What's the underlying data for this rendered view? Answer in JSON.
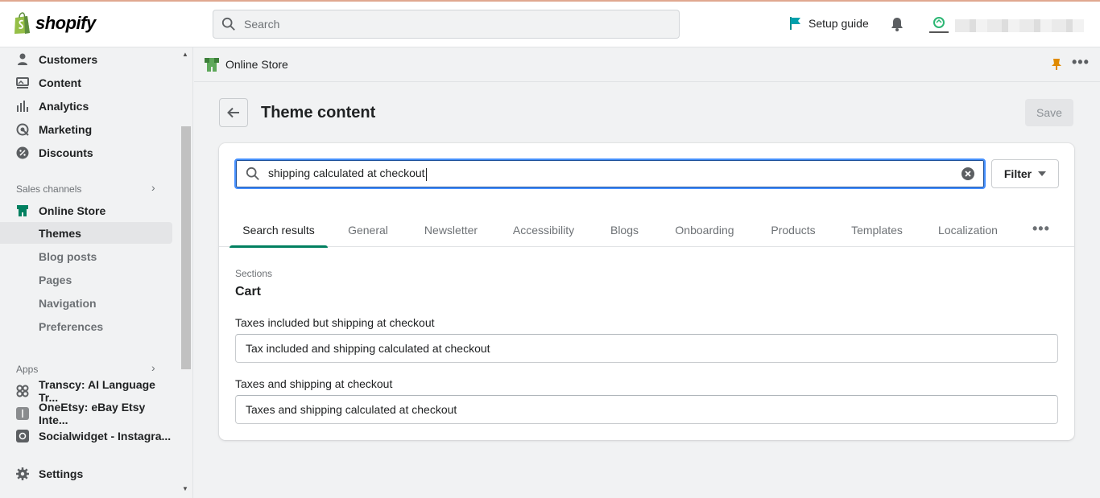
{
  "topbar": {
    "brand": "shopify",
    "search_placeholder": "Search",
    "setup_guide": "Setup guide"
  },
  "sidebar": {
    "items": [
      {
        "label": "Customers",
        "icon": "person-icon"
      },
      {
        "label": "Content",
        "icon": "content-icon"
      },
      {
        "label": "Analytics",
        "icon": "bar-chart-icon"
      },
      {
        "label": "Marketing",
        "icon": "target-icon"
      },
      {
        "label": "Discounts",
        "icon": "discount-icon"
      }
    ],
    "sales_channels_label": "Sales channels",
    "online_store_label": "Online Store",
    "sub_items": [
      "Themes",
      "Blog posts",
      "Pages",
      "Navigation",
      "Preferences"
    ],
    "apps_label": "Apps",
    "apps": [
      {
        "label": "Transcy: AI Language Tr...",
        "icon": "transcy-icon"
      },
      {
        "label": "OneEtsy: eBay Etsy Inte...",
        "icon": "oneetsy-icon"
      },
      {
        "label": "Socialwidget - Instagra...",
        "icon": "socialwidget-icon"
      }
    ],
    "settings_label": "Settings"
  },
  "subheader": {
    "title": "Online Store"
  },
  "page": {
    "title": "Theme content",
    "save_label": "Save"
  },
  "content": {
    "search_value": "shipping calculated at checkout",
    "filter_label": "Filter",
    "tabs": [
      "Search results",
      "General",
      "Newsletter",
      "Accessibility",
      "Blogs",
      "Onboarding",
      "Products",
      "Templates",
      "Localization"
    ],
    "active_tab": "Search results",
    "section_label": "Sections",
    "section_title": "Cart",
    "fields": [
      {
        "label": "Taxes included but shipping at checkout",
        "value": "Tax included and shipping calculated at checkout"
      },
      {
        "label": "Taxes and shipping at checkout",
        "value": "Taxes and shipping calculated at checkout"
      }
    ]
  },
  "colors": {
    "accent": "#008060",
    "focus": "#458fff",
    "brand_green": "#95bf47"
  }
}
